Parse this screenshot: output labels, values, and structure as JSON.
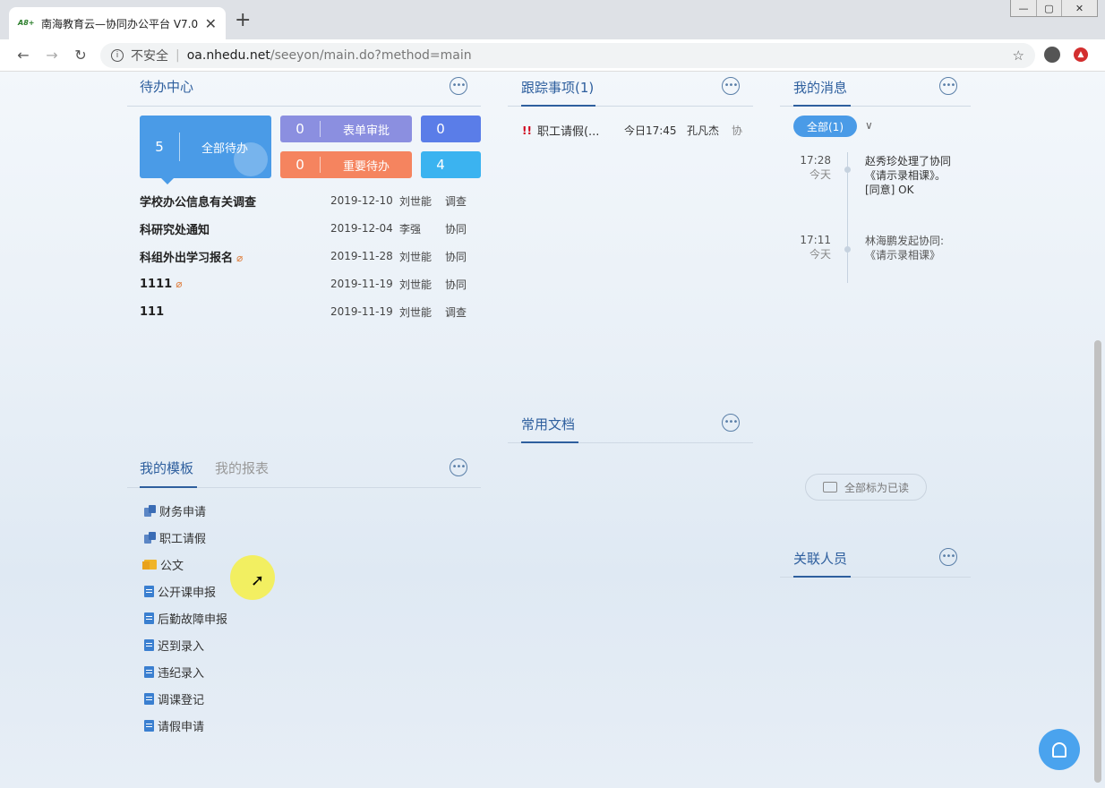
{
  "browser": {
    "tab_title": "南海教育云—协同办公平台 V7.0",
    "favicon_text": "A8+",
    "close_glyph": "✕",
    "newtab_glyph": "+",
    "insecure_label": "不安全",
    "url_host": "oa.nhedu.net",
    "url_path": "/seeyon/main.do?method=main",
    "win_min": "—",
    "win_max": "▢",
    "win_close": "✕"
  },
  "pending": {
    "title": "待办中心",
    "main_card": {
      "count": "5",
      "label": "全部待办"
    },
    "cards": [
      {
        "count": "0",
        "label": "表单审批",
        "color": "#8b8fe0"
      },
      {
        "count": "0",
        "label": "",
        "color": "#5a7de8"
      },
      {
        "count": "0",
        "label": "重要待办",
        "color": "#f5845f"
      },
      {
        "count": "4",
        "label": "",
        "color": "#3bb3f0"
      }
    ],
    "rows": [
      {
        "title": "学校办公信息有关调查",
        "clip": false,
        "date": "2019-12-10",
        "person": "刘世能",
        "kind": "调查"
      },
      {
        "title": "科研究处通知",
        "clip": false,
        "date": "2019-12-04",
        "person": "李强",
        "kind": "协同"
      },
      {
        "title": "科组外出学习报名",
        "clip": true,
        "date": "2019-11-28",
        "person": "刘世能",
        "kind": "协同"
      },
      {
        "title": "1111",
        "clip": true,
        "date": "2019-11-19",
        "person": "刘世能",
        "kind": "协同"
      },
      {
        "title": "111",
        "clip": false,
        "date": "2019-11-19",
        "person": "刘世能",
        "kind": "调查"
      }
    ]
  },
  "follow": {
    "title": "跟踪事项(1)",
    "row": {
      "title": "职工请假(...",
      "time": "今日17:45",
      "person": "孔凡杰",
      "kind": "协"
    }
  },
  "docs": {
    "title": "常用文档"
  },
  "messages": {
    "title": "我的消息",
    "filter_label": "全部(1)",
    "items": [
      {
        "time": "17:28",
        "day": "今天",
        "text": "赵秀珍处理了协同《请示录相课》。",
        "extra": "[同意] OK"
      },
      {
        "time": "17:11",
        "day": "今天",
        "text": "林海鹏发起协同:《请示录相课》",
        "extra": ""
      }
    ],
    "read_all": "全部标为已读"
  },
  "related": {
    "title": "关联人员"
  },
  "templates": {
    "tab_active": "我的模板",
    "tab_inactive": "我的报表",
    "items": [
      {
        "label": "财务申请",
        "icon": "flow-icon"
      },
      {
        "label": "职工请假",
        "icon": "flow-icon"
      },
      {
        "label": "公文",
        "icon": "folder-icon"
      },
      {
        "label": "公开课申报",
        "icon": "doc-icon"
      },
      {
        "label": "后勤故障申报",
        "icon": "doc-icon"
      },
      {
        "label": "迟到录入",
        "icon": "doc-icon"
      },
      {
        "label": "违纪录入",
        "icon": "doc-icon"
      },
      {
        "label": "调课登记",
        "icon": "doc-icon"
      },
      {
        "label": "请假申请",
        "icon": "doc-icon"
      }
    ]
  },
  "more_glyph": "•••",
  "colors": {
    "accent": "#2e5f9e",
    "primary": "#4a9be7"
  }
}
